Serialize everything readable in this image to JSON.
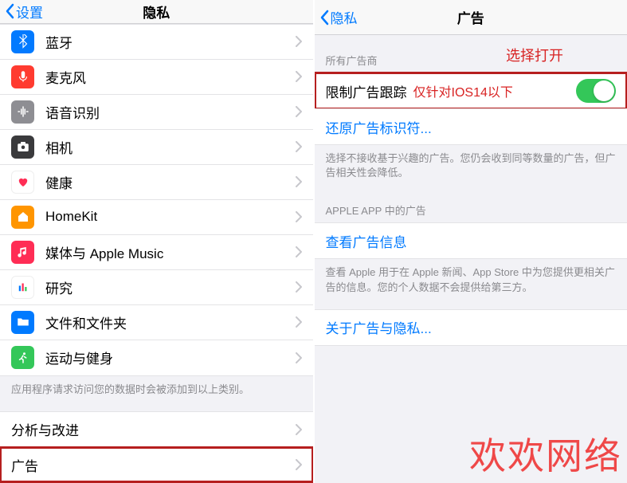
{
  "left": {
    "back_label": "设置",
    "title": "隐私",
    "rows": [
      {
        "key": "bluetooth",
        "label": "蓝牙"
      },
      {
        "key": "microphone",
        "label": "麦克风"
      },
      {
        "key": "speech",
        "label": "语音识别"
      },
      {
        "key": "camera",
        "label": "相机"
      },
      {
        "key": "health",
        "label": "健康"
      },
      {
        "key": "homekit",
        "label": "HomeKit"
      },
      {
        "key": "media",
        "label": "媒体与 Apple Music"
      },
      {
        "key": "research",
        "label": "研究"
      },
      {
        "key": "files",
        "label": "文件和文件夹"
      },
      {
        "key": "motion",
        "label": "运动与健身"
      }
    ],
    "footer1": "应用程序请求访问您的数据时会被添加到以上类别。",
    "rows2": [
      {
        "key": "analytics",
        "label": "分析与改进"
      },
      {
        "key": "advertising",
        "label": "广告",
        "highlighted": true
      }
    ]
  },
  "right": {
    "back_label": "隐私",
    "title": "广告",
    "annot_open": "选择打开",
    "section1_header": "所有广告商",
    "toggle_label": "限制广告跟踪",
    "toggle_note": "仅针对IOS14以下",
    "toggle_on": true,
    "reset_link": "还原广告标识符...",
    "section1_footer": "选择不接收基于兴趣的广告。您仍会收到同等数量的广告，但广告相关性会降低。",
    "section2_header": "APPLE APP 中的广告",
    "view_info_link": "查看广告信息",
    "section2_footer": "查看 Apple 用于在 Apple 新闻、App Store 中为您提供更相关广告的信息。您的个人数据不会提供给第三方。",
    "about_link": "关于广告与隐私...",
    "highlight_toggle": true
  },
  "watermark": "欢欢网络",
  "colors": {
    "ios_blue": "#007aff",
    "ios_green": "#34c759",
    "annot_red": "#d82323",
    "box_red": "#b61f1f"
  }
}
